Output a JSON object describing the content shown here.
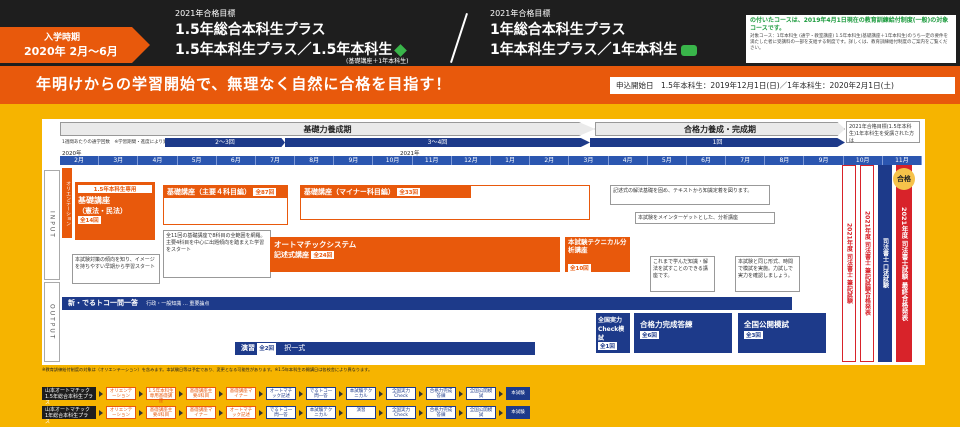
{
  "badge": {
    "line1": "入学時期",
    "line2": "2020年 2月〜6月"
  },
  "header": {
    "left_target": "2021年合格目標",
    "left_line1": "1.5年総合本科生プラス",
    "left_line2": "1.5年本科生プラス／1.5年本科生",
    "left_note": "(基礎講座＋1年本科生)",
    "right_target": "2021年合格目標",
    "right_line1": "1年総合本科生プラス",
    "right_line2": "1年本科生プラス／1年本科生"
  },
  "notice": {
    "title": "の付いたコースは、2019年4月1日現在の教育訓練給付制度(一般)の対象コースです。",
    "sub": "対象コース：1年本科生 (通学・教室講座) 1.5年本科生(基礎講座＋1年本科生)のうち一定の要件を満たした者に受講料の一部を支給する制度です。詳しくは、教育訓練給付制度のご案内をご覧ください。"
  },
  "banner": {
    "message": "年明けからの学習開始で、無理なく自然に合格を目指す！",
    "apply": "申込開始日　1.5年本科生：2019年12月1日(日)／1年本科生：2020年2月1日(土)"
  },
  "phases": {
    "basic": "基礎力養成期",
    "advanced": "合格力養成・完成期"
  },
  "counts": {
    "c1": "2〜3回",
    "c2": "3〜4回",
    "c3": "1回"
  },
  "timeline": {
    "note": "1週間あたりの通学回数　※学習期間・進度により異なります。",
    "year2020": "2020年",
    "year2021": "2021年",
    "months": [
      "2月",
      "3月",
      "4月",
      "5月",
      "6月",
      "7月",
      "8月",
      "9月",
      "10月",
      "11月",
      "12月",
      "1月",
      "2月",
      "3月",
      "4月",
      "5月",
      "6月",
      "7月",
      "8月",
      "9月",
      "10月",
      "11月"
    ]
  },
  "side": {
    "input": "INPUT",
    "output": "OUTPUT",
    "orientation": "オリエンテーション"
  },
  "courses": {
    "c1": {
      "tag": "1.5年本科生専用",
      "title": "基礎講座",
      "sub": "（憲法・民法）",
      "count": "全14回"
    },
    "c2": {
      "title": "基礎講座（主要４科目編）",
      "count": "全87回"
    },
    "c3": {
      "title": "基礎講座（マイナー科目編）",
      "count": "全33回"
    },
    "c3b": {
      "title": "オートマチックシステム",
      "sub": "記述式講座",
      "count": "全24回"
    },
    "c4": {
      "title": "本試験テクニカル分析講座",
      "count": "全10回"
    },
    "c5": {
      "title": "新・でるトコ一問一答",
      "sub": "行政・一般知識 … 重要論点"
    },
    "c6": {
      "title": "演習",
      "count": "全2回",
      "sub": "択一式"
    },
    "c7": {
      "title": "全国実力Check模試",
      "count": "全1回"
    },
    "c8": {
      "title": "合格力完成答練",
      "count": "全6回"
    },
    "c9": {
      "title": "全国公開模試",
      "count": "全3回"
    }
  },
  "exams": {
    "e1": "2021年度 司法書士 筆記試験",
    "e2": "2021年度 司法書士 筆記試験合格発表",
    "e3": "司法書士 口述試験",
    "e4": "2021年度 司法書士試験 最終合格発表",
    "pass": "合格",
    "note": "2021年合格目標(1.5年本科生)1年本科生を受講された方は"
  },
  "notes": {
    "n1": "本試験対策の傾向を知り、イメージを持ちやすい早期から学習スタート",
    "n2": "全11回の基礎講座で8科目の全範囲を網羅。主要4科目を中心に出題傾向を踏まえた学習をスタート",
    "n3": "記述式の解法基礎を固め、テキストから知識定着を図ります。",
    "n4": "本試験をメインターゲットとした、分析講座",
    "n5": "これまで学んだ知識・解法を試すことのできる講座です。",
    "n6": "本試験と同じ形式、時間で模試を実施。力試しで実力を確認しましょう。"
  },
  "footnote": "※教育訓練給付制度の対象は（オリエンテーション）を含みます。本試験日等は予定であり、変更となる可能性があります。※1.5年本科生の開講日は各校舎により異なります。",
  "flow1": {
    "start": "山本オートマチック 1.5年総合本科生プラス",
    "items": [
      "オリエンテーション",
      "1.5年本科生専用基礎講座",
      "基礎講座主要4科目",
      "基礎講座マイナー",
      "オートマチック記述",
      "でるトコ一問一答",
      "本試験テクニカル",
      "全国実力Check",
      "合格力完成答練",
      "全国公開模試"
    ],
    "end": "本試験"
  },
  "flow2": {
    "start": "山本オートマチック 1年総合本科生プラス",
    "items": [
      "オリエンテーション",
      "基礎講座主要4科目",
      "基礎講座マイナー",
      "オートマチック記述",
      "でるトコ一問一答",
      "本試験テクニカル",
      "演習",
      "全国実力Check",
      "合格力完成答練",
      "全国公開模試"
    ],
    "end": "本試験"
  }
}
